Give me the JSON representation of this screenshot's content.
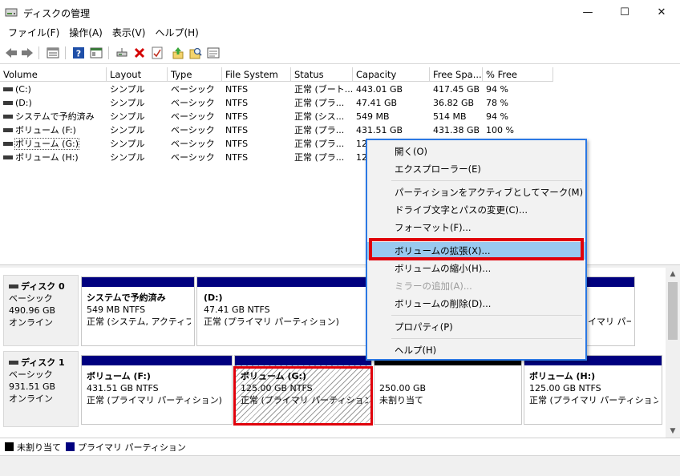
{
  "window": {
    "title": "ディスクの管理",
    "minimize_glyph": "—",
    "maximize_glyph": "☐",
    "close_glyph": "✕"
  },
  "menu": [
    "ファイル(F)",
    "操作(A)",
    "表示(V)",
    "ヘルプ(H)"
  ],
  "toolbar_icons": [
    "back-icon",
    "forward-icon",
    "disk-list-icon",
    "help-icon",
    "console-icon",
    "connect-icon",
    "delete-icon",
    "checklist-icon",
    "import-icon",
    "search-icon",
    "properties-icon"
  ],
  "volume_table": {
    "headers": [
      "Volume",
      "Layout",
      "Type",
      "File System",
      "Status",
      "Capacity",
      "Free Spa...",
      "% Free"
    ],
    "rows": [
      [
        "(C:)",
        "シンプル",
        "ベーシック",
        "NTFS",
        "正常 (ブート...",
        "443.01 GB",
        "417.45 GB",
        "94 %"
      ],
      [
        "(D:)",
        "シンプル",
        "ベーシック",
        "NTFS",
        "正常 (プラ...",
        "47.41 GB",
        "36.82 GB",
        "78 %"
      ],
      [
        "システムで予約済み",
        "シンプル",
        "ベーシック",
        "NTFS",
        "正常 (シス...",
        "549 MB",
        "514 MB",
        "94 %"
      ],
      [
        "ボリューム (F:)",
        "シンプル",
        "ベーシック",
        "NTFS",
        "正常 (プラ...",
        "431.51 GB",
        "431.38 GB",
        "100 %"
      ],
      [
        "ボリューム (G:)",
        "シンプル",
        "ベーシック",
        "NTFS",
        "正常 (プラ...",
        "12",
        "",
        ""
      ],
      [
        "ボリューム (H:)",
        "シンプル",
        "ベーシック",
        "NTFS",
        "正常 (プラ...",
        "12",
        "",
        ""
      ]
    ]
  },
  "disks": [
    {
      "name": "ディスク 0",
      "type": "ベーシック",
      "size": "490.96 GB",
      "state": "オンライン",
      "partitions": [
        {
          "name": "システムで予約済み",
          "size": "549 MB NTFS",
          "status": "正常 (システム, アクティブ, プ"
        },
        {
          "name": "(D:)",
          "size": "47.41 GB NTFS",
          "status": "正常 (プライマリ パーティション)"
        },
        {
          "name": "",
          "size": "",
          "status": "イマリ パーテ"
        }
      ]
    },
    {
      "name": "ディスク 1",
      "type": "ベーシック",
      "size": "931.51 GB",
      "state": "オンライン",
      "partitions": [
        {
          "name": "ボリューム  (F:)",
          "size": "431.51 GB NTFS",
          "status": "正常 (プライマリ パーティション)"
        },
        {
          "name": "ボリューム  (G:)",
          "size": "125.00 GB NTFS",
          "status": "正常 (プライマリ パーティション)"
        },
        {
          "name": "",
          "size": "250.00 GB",
          "status": "未割り当て"
        },
        {
          "name": "ボリューム  (H:)",
          "size": "125.00 GB NTFS",
          "status": "正常 (プライマリ パーティション)"
        }
      ]
    }
  ],
  "legend": {
    "unallocated": "未割り当て",
    "primary": "プライマリ パーティション",
    "unallocated_color": "#000000",
    "primary_color": "#00007f"
  },
  "context_menu": {
    "items": [
      {
        "label": "開く(O)",
        "disabled": false
      },
      {
        "label": "エクスプローラー(E)",
        "disabled": false
      },
      {
        "label": "パーティションをアクティブとしてマーク(M)",
        "disabled": false
      },
      {
        "label": "ドライブ文字とパスの変更(C)...",
        "disabled": false
      },
      {
        "label": "フォーマット(F)...",
        "disabled": false
      },
      {
        "label": "ボリュームの拡張(X)...",
        "disabled": false,
        "highlighted": true
      },
      {
        "label": "ボリュームの縮小(H)...",
        "disabled": false
      },
      {
        "label": "ミラーの追加(A)...",
        "disabled": true
      },
      {
        "label": "ボリュームの削除(D)...",
        "disabled": false
      },
      {
        "label": "プロパティ(P)",
        "disabled": false
      },
      {
        "label": "ヘルプ(H)",
        "disabled": false
      }
    ],
    "border_color": "#2b78e4",
    "highlight_color": "#99c9ef"
  },
  "annotation_color": "#e0000a"
}
